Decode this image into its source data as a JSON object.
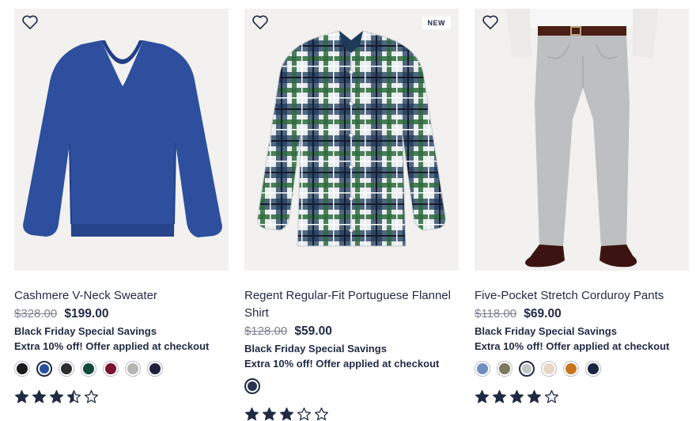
{
  "products": [
    {
      "name": "Cashmere V-Neck Sweater",
      "original_price": "$328.00",
      "sale_price": "$199.00",
      "promo_title": "Black Friday Special Savings",
      "promo_text": "Extra 10% off! Offer applied at checkout",
      "badge": "",
      "swatches": [
        "#1b1b1b",
        "#2b4f9c",
        "#2e2e2e",
        "#0f4a3c",
        "#7a1430",
        "#b5b5b2",
        "#1e2140"
      ],
      "selected_swatch": 1,
      "rating": 3.5,
      "rating_max": 5
    },
    {
      "name": "Regent Regular-Fit Portuguese Flannel Shirt",
      "original_price": "$128.00",
      "sale_price": "$59.00",
      "promo_title": "Black Friday Special Savings",
      "promo_text": "Extra 10% off! Offer applied at checkout",
      "badge": "NEW",
      "swatches": [
        "#2a3450"
      ],
      "selected_swatch": 0,
      "rating": 3,
      "rating_max": 5
    },
    {
      "name": "Five-Pocket Stretch Corduroy Pants",
      "original_price": "$118.00",
      "sale_price": "$69.00",
      "promo_title": "Black Friday Special Savings",
      "promo_text": "Extra 10% off! Offer applied at checkout",
      "badge": "",
      "swatches": [
        "#6f8fc3",
        "#7d7a5e",
        "#c4c4c4",
        "#e7d8c6",
        "#c9731f",
        "#1b2642"
      ],
      "selected_swatch": 2,
      "rating": 4,
      "rating_max": 5
    }
  ],
  "icons": {
    "wishlist": "heart-outline-icon",
    "star_full": "star-filled-icon",
    "star_half": "star-half-icon",
    "star_empty": "star-outline-icon"
  },
  "colors": {
    "text": "#1f2a44",
    "strike": "#7d8190",
    "star": "#1f2a44",
    "image_bg": "#f1f0ee"
  }
}
